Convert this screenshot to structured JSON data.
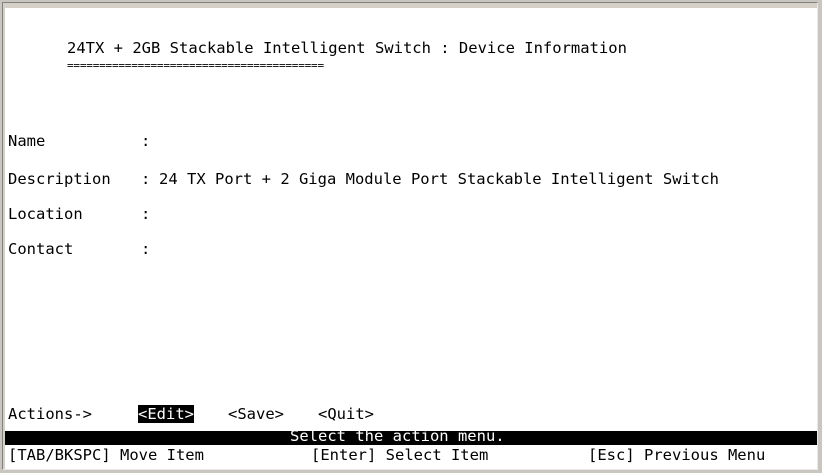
{
  "header": {
    "title": "24TX + 2GB Stackable Intelligent Switch : Device Information",
    "underline": "========================================"
  },
  "fields": [
    {
      "label": "Name",
      "separator": ":",
      "value": ""
    },
    {
      "label": "Description",
      "separator": ":",
      "value": "24 TX Port + 2 Giga Module Port Stackable Intelligent Switch"
    },
    {
      "label": "Location",
      "separator": ":",
      "value": ""
    },
    {
      "label": "Contact",
      "separator": ":",
      "value": ""
    }
  ],
  "actions": {
    "label": "Actions->",
    "edit": "<Edit>",
    "save": "<Save>",
    "quit": "<Quit>"
  },
  "status": "Select the action menu.",
  "help": {
    "move": "[TAB/BKSPC] Move Item",
    "select": "[Enter] Select Item",
    "previous": "[Esc] Previous Menu"
  },
  "colors": {
    "terminal_bg": "#ffffff",
    "text": "#000000",
    "highlight_bg": "#000000",
    "highlight_text": "#ffffff"
  }
}
